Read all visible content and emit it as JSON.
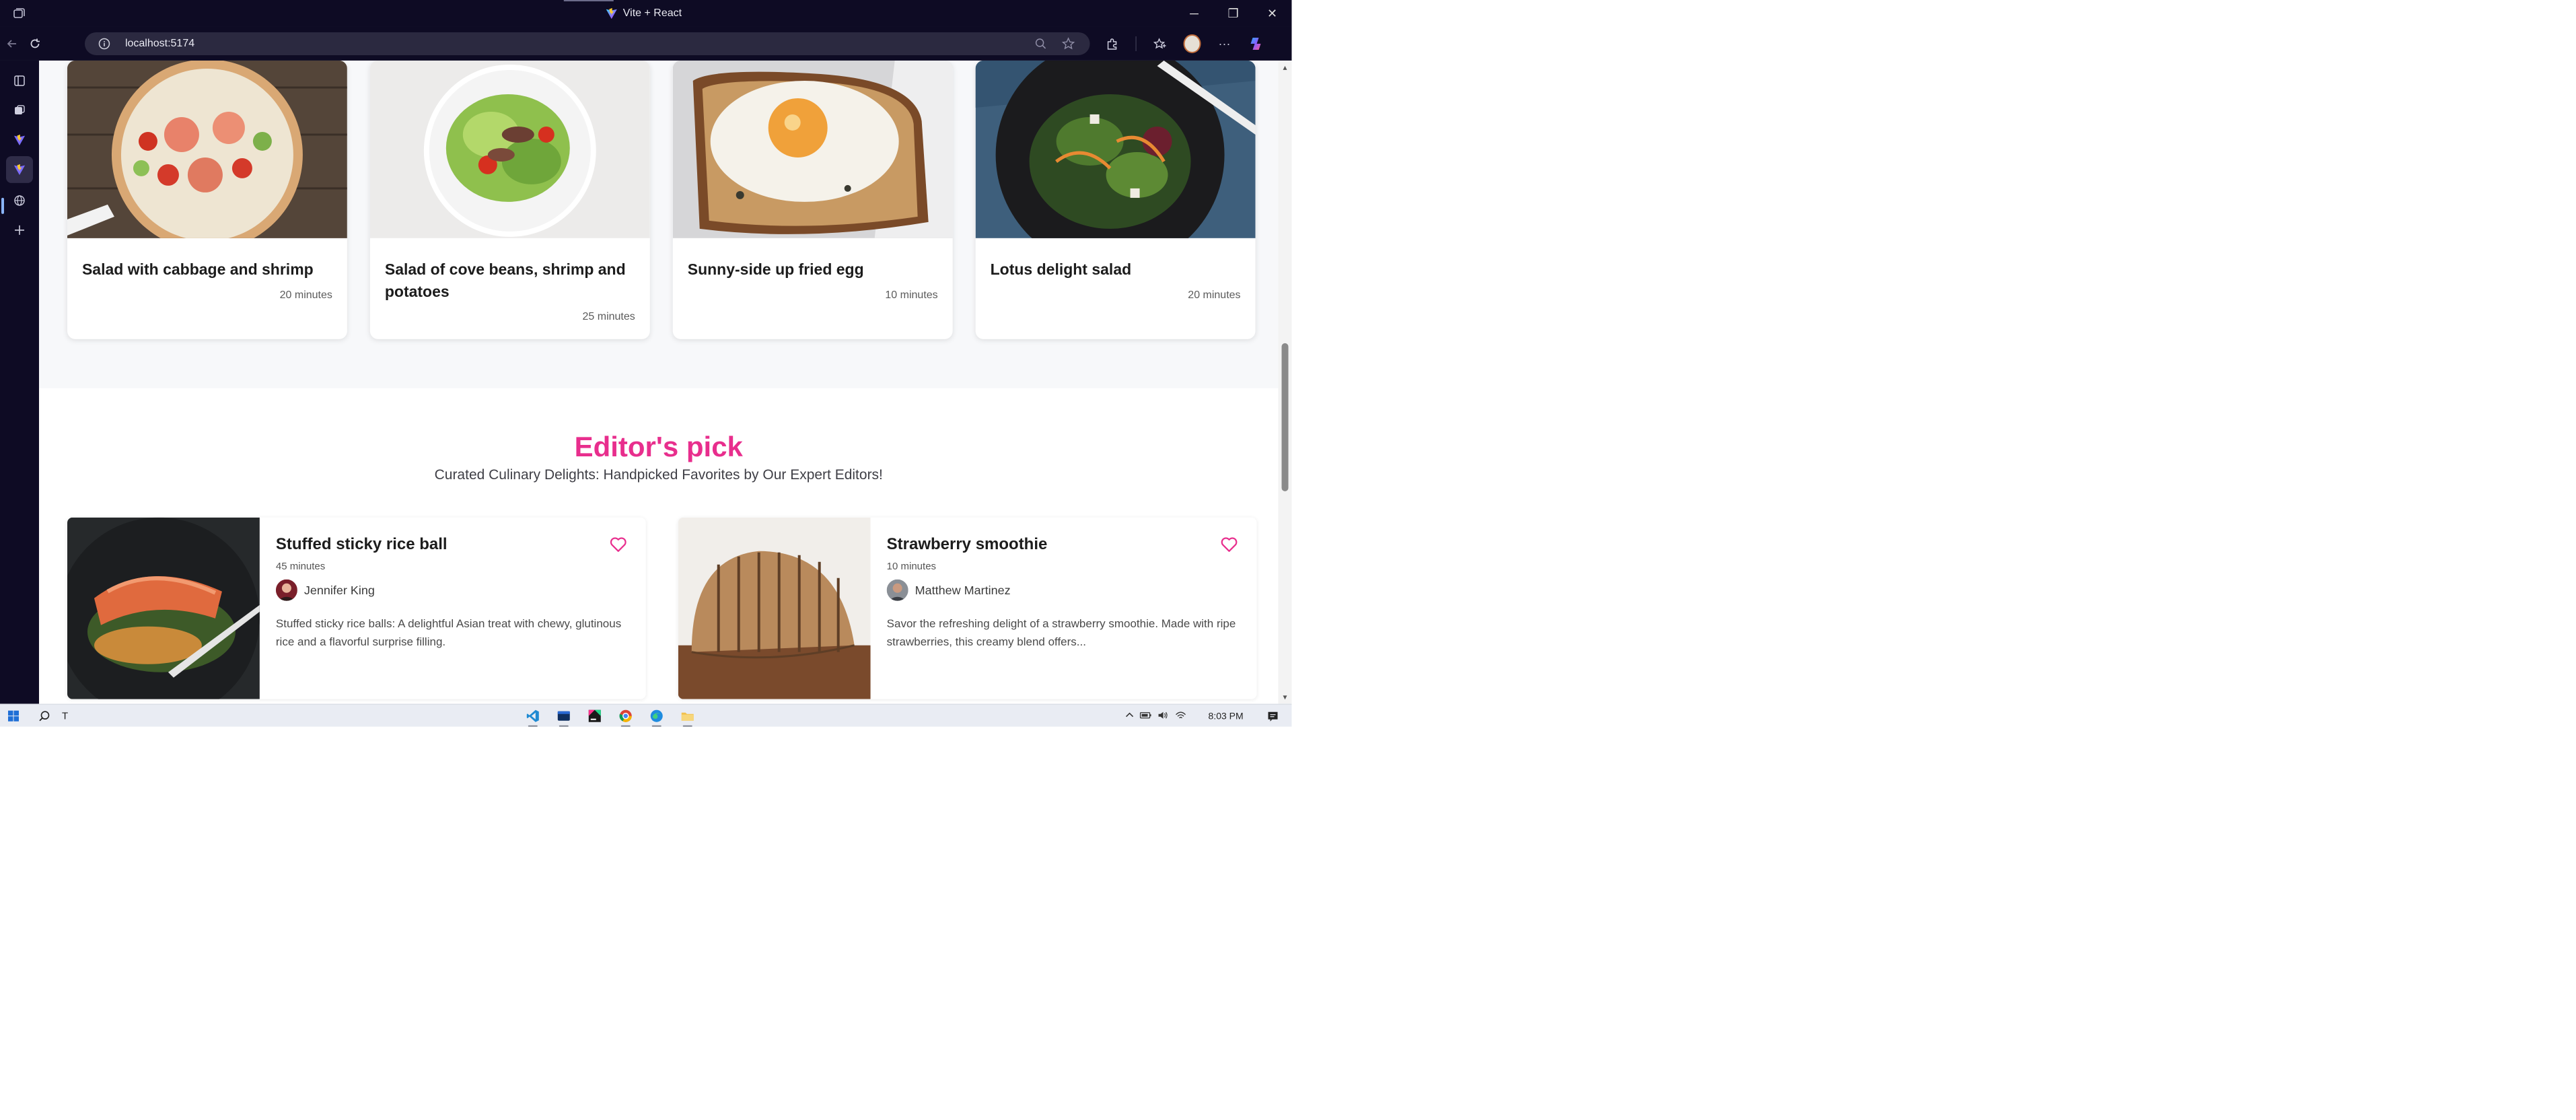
{
  "browser": {
    "tab_title": "Vite + React",
    "url": "localhost:5174",
    "caption": {
      "minimize": "─",
      "restore": "❐",
      "close": "✕"
    },
    "more_label": "···"
  },
  "recipes": [
    {
      "title": "Salad with cabbage and shrimp",
      "time": "20 minutes"
    },
    {
      "title": "Salad of cove beans, shrimp and potatoes",
      "time": "25 minutes"
    },
    {
      "title": "Sunny-side up fried egg",
      "time": "10 minutes"
    },
    {
      "title": "Lotus delight salad",
      "time": "20 minutes"
    }
  ],
  "editors_pick": {
    "heading": "Editor's pick",
    "subheading": "Curated Culinary Delights: Handpicked Favorites by Our Expert Editors!",
    "items": [
      {
        "title": "Stuffed sticky rice ball",
        "time": "45 minutes",
        "author": "Jennifer King",
        "description": "Stuffed sticky rice balls: A delightful Asian treat with chewy, glutinous rice and a flavorful surprise filling."
      },
      {
        "title": "Strawberry smoothie",
        "time": "10 minutes",
        "author": "Matthew Martinez",
        "description": "Savor the refreshing delight of a strawberry smoothie. Made with ripe strawberries, this creamy blend offers..."
      }
    ]
  },
  "taskbar": {
    "search_text": "T",
    "clock": "8:03 PM"
  },
  "colors": {
    "accent_pink": "#e82e8d",
    "browser_chrome": "#0e0b24"
  }
}
